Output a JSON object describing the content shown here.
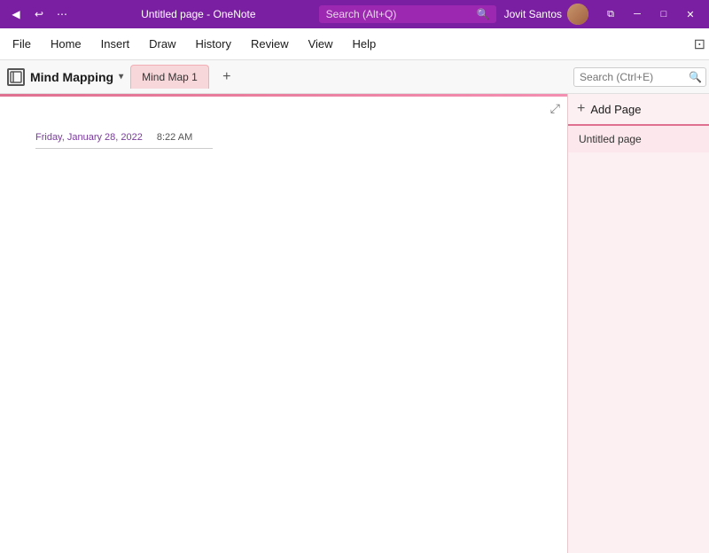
{
  "titlebar": {
    "back_icon": "◀",
    "undo_icon": "↩",
    "more_icon": "•••",
    "title": "Untitled page - OneNote",
    "search_placeholder": "Search (Alt+Q)",
    "user_name": "Jovit Santos",
    "restore_icon": "⧉",
    "minimize_icon": "─",
    "maximize_icon": "□",
    "close_icon": "✕"
  },
  "menubar": {
    "items": [
      {
        "label": "File"
      },
      {
        "label": "Home"
      },
      {
        "label": "Insert"
      },
      {
        "label": "Draw"
      },
      {
        "label": "History"
      },
      {
        "label": "Review"
      },
      {
        "label": "View"
      },
      {
        "label": "Help"
      }
    ]
  },
  "notebookbar": {
    "notebook_name": "Mind Mapping",
    "page_tab": "Mind Map 1",
    "add_tab_icon": "+",
    "search_placeholder": "Search (Ctrl+E)",
    "search_icon": "🔍"
  },
  "page": {
    "expand_icon": "⤢",
    "date": "Friday, January 28, 2022",
    "time": "8:22 AM"
  },
  "sidebar": {
    "add_page_label": "Add Page",
    "add_page_icon": "+",
    "pages": [
      {
        "label": "Untitled page"
      }
    ]
  }
}
